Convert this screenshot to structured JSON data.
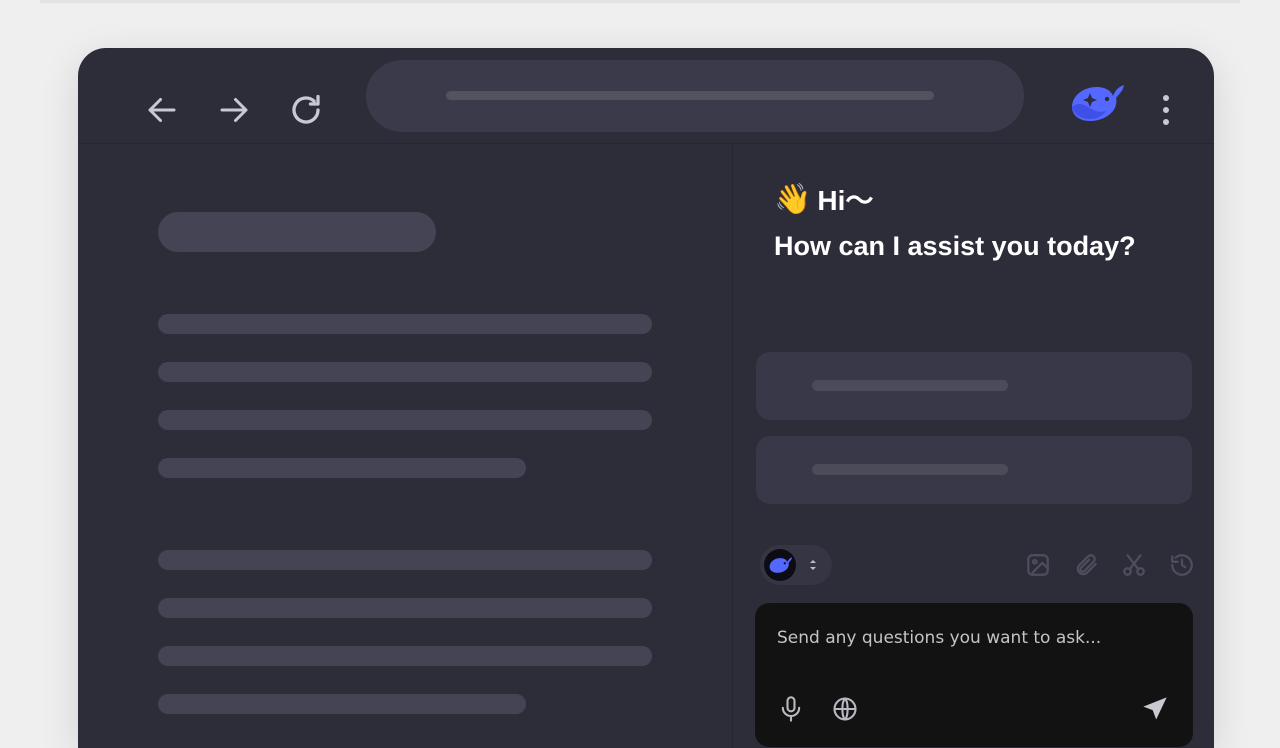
{
  "chat": {
    "greeting_emoji": "👋",
    "greeting": "Hi～",
    "subtitle": "How can I assist you today?",
    "input_placeholder": "Send any questions you want to ask..."
  },
  "icons": {
    "back": "arrow-left-icon",
    "forward": "arrow-right-icon",
    "reload": "reload-icon",
    "brand": "whale-icon",
    "menu": "more-vertical-icon",
    "image": "image-icon",
    "attach": "paperclip-icon",
    "screenshot": "scissors-icon",
    "history": "history-icon",
    "new_chat": "new-chat-icon",
    "mic": "microphone-icon",
    "web": "globe-icon",
    "send": "send-icon"
  },
  "colors": {
    "background": "#efefef",
    "window": "#2d2d3a",
    "accent": "#5468ff",
    "input_box": "#121212"
  }
}
